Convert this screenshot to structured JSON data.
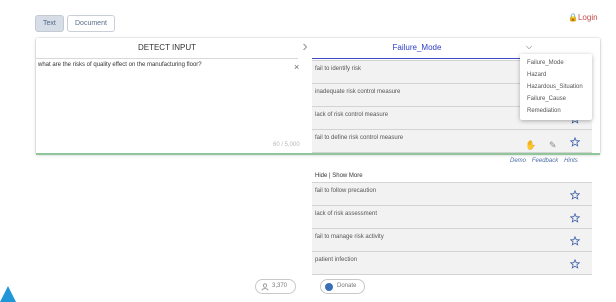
{
  "toolbar": {
    "text_label": "Text",
    "document_label": "Document",
    "login_label": "Login"
  },
  "left_pane": {
    "header": "DETECT INPUT",
    "input_value": "what are the risks of quality effect on the manufacturing floor?",
    "clear_symbol": "×",
    "char_count": "60 / 5,000"
  },
  "right_pane": {
    "header": "Failure_Mode",
    "results": [
      "fail to identify risk",
      "inadequate risk control measure",
      "lack of risk control measure",
      "fail to define risk control measure"
    ],
    "actions": {
      "demo": "Demo",
      "feedback": "Feedback",
      "hints": "Hints"
    }
  },
  "dropdown": {
    "options": [
      "Failure_Mode",
      "Hazard",
      "Hazardous_Situation",
      "Failure_Cause",
      "Remediation"
    ]
  },
  "more": {
    "hide": "Hide",
    "separator": "|",
    "show_more": "Show More",
    "results": [
      "fail to follow precaution",
      "lack of risk assessment",
      "fail to manage risk activity",
      "patient infection"
    ]
  },
  "footer": {
    "users": "3,370",
    "donate": "Donate"
  },
  "colors": {
    "accent_blue": "#2e3ec6",
    "success_green": "#8fc79a",
    "login_red": "#c14a4a"
  }
}
